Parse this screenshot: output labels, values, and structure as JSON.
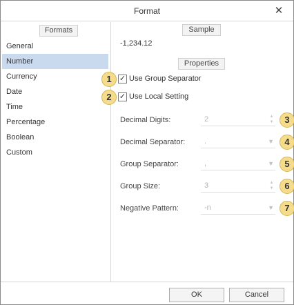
{
  "window": {
    "title": "Format",
    "close_glyph": "✕"
  },
  "formats_panel": {
    "header": "Formats",
    "items": [
      "General",
      "Number",
      "Currency",
      "Date",
      "Time",
      "Percentage",
      "Boolean",
      "Custom"
    ],
    "selected": "Number"
  },
  "sample": {
    "header": "Sample",
    "value": "-1,234.12"
  },
  "properties": {
    "header": "Properties",
    "use_group_separator": {
      "badge": "1",
      "label": "Use Group Separator",
      "checked": true
    },
    "use_local_setting": {
      "badge": "2",
      "label": "Use Local Setting",
      "checked": true
    },
    "decimal_digits": {
      "badge": "3",
      "label": "Decimal Digits:",
      "value": "2"
    },
    "decimal_separator": {
      "badge": "4",
      "label": "Decimal Separator:",
      "value": "."
    },
    "group_separator": {
      "badge": "5",
      "label": "Group Separator:",
      "value": ","
    },
    "group_size": {
      "badge": "6",
      "label": "Group Size:",
      "value": "3"
    },
    "negative_pattern": {
      "badge": "7",
      "label": "Negative Pattern:",
      "value": "-n"
    }
  },
  "buttons": {
    "ok": "OK",
    "cancel": "Cancel"
  },
  "icons": {
    "close": "close-icon",
    "checkmark": "checkmark-icon",
    "spin_up": "spin-up-icon",
    "spin_down": "spin-down-icon",
    "dropdown": "chevron-down-icon"
  },
  "colors": {
    "selected_item": "#c9d9ee",
    "badge_fill": "#f5dc8c",
    "badge_border": "#d7b84e",
    "disabled_text": "#b5b5b5"
  }
}
